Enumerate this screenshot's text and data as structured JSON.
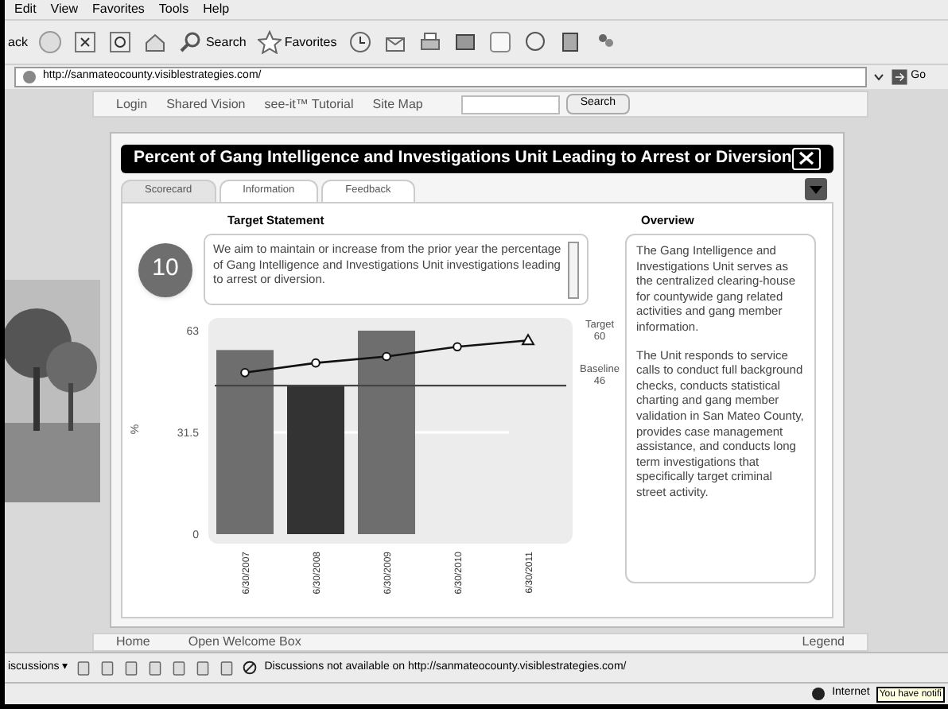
{
  "menu": [
    "Edit",
    "View",
    "Favorites",
    "Tools",
    "Help"
  ],
  "toolbar": {
    "back": "ack",
    "search": "Search",
    "favorites": "Favorites"
  },
  "address": {
    "url": "http://sanmateocounty.visiblestrategies.com/",
    "go": "Go"
  },
  "site_nav": {
    "links": [
      "Login",
      "Shared Vision",
      "see-it™ Tutorial",
      "Site Map"
    ],
    "search_button": "Search"
  },
  "dialog": {
    "title": "Percent of Gang Intelligence and Investigations Unit Leading to Arrest or Diversion",
    "tabs": [
      {
        "label": "Scorecard",
        "selected": true
      },
      {
        "label": "Information",
        "selected": false
      },
      {
        "label": "Feedback",
        "selected": false
      }
    ],
    "target_label": "Target Statement",
    "score": "10",
    "statement": "We aim to maintain or increase from the prior year the percentage of Gang Intelligence and Investigations Unit investigations leading to arrest or diversion.",
    "overview_label": "Overview",
    "overview": [
      "The Gang Intelligence and Investigations Unit serves as the centralized clearing-house for countywide gang related activities and gang member information.",
      "The Unit responds to service calls to conduct full background checks, conducts statistical charting and gang member validation in San Mateo County, provides case management assistance, and conducts long term investigations that specifically target criminal street activity."
    ],
    "chart_data": {
      "type": "bar",
      "ylabel": "%",
      "categories": [
        "6/30/2007",
        "6/30/2008",
        "6/30/2009",
        "6/30/2010",
        "6/30/2011"
      ],
      "ylim": [
        0,
        63
      ],
      "yticks": [
        0,
        31.5,
        63
      ],
      "series": [
        {
          "type": "bar",
          "color": "#6e6e6e",
          "colors": [
            null,
            "#333333",
            null,
            null,
            null
          ],
          "values": [
            57,
            46,
            63,
            null,
            null
          ]
        },
        {
          "type": "line",
          "color": "#111111",
          "marker": "o",
          "values": [
            50,
            53,
            55,
            58,
            60
          ]
        },
        {
          "type": "line",
          "color": "#444444",
          "values": [
            46,
            46,
            46,
            46,
            46
          ]
        }
      ],
      "annotations": [
        {
          "text": "Target"
        },
        {
          "text": "60"
        },
        {
          "text": "Baseline"
        },
        {
          "text": "46"
        }
      ]
    }
  },
  "footer": [
    "Home",
    "Open Welcome Box",
    "Legend"
  ],
  "discussions": {
    "label": "iscussions ▾",
    "message": "Discussions not available on http://sanmateocounty.visiblestrategies.com/"
  },
  "status": {
    "zone": "Internet",
    "tooltip": "You have notifi"
  }
}
